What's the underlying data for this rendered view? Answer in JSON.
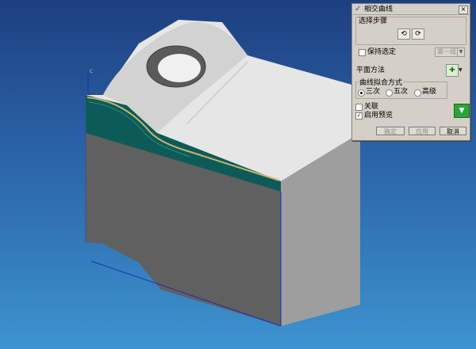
{
  "dialog": {
    "title": "相交曲线",
    "close_label": "×",
    "select_step": {
      "label": "选择步骤",
      "icons": [
        "first-face-icon",
        "second-face-icon"
      ]
    },
    "keep_selected": {
      "label": "保持选定",
      "checked": false
    },
    "set_dropdown": {
      "value": "第一组"
    },
    "plane_method": {
      "label": "平面方法",
      "icon": "plane-tool-icon"
    },
    "curve_fit": {
      "label": "曲线拟合方式",
      "options": [
        {
          "label": "三次",
          "selected": true
        },
        {
          "label": "五次",
          "selected": false
        },
        {
          "label": "高级",
          "selected": false
        }
      ]
    },
    "associate": {
      "label": "关联",
      "checked": false
    },
    "preview": {
      "label": "启用预览",
      "checked": true
    },
    "buttons": {
      "ok": "确定",
      "apply": "应用",
      "cancel": "取消"
    }
  },
  "viewport": {
    "axis_label": "C",
    "colors": {
      "background_top": "#1d3f80",
      "background_bottom": "#3d93cf",
      "top_face": "#e6e6e6",
      "side_face": "#606060",
      "right_face": "#9e9e9e",
      "band": "#0d5b58",
      "curve": "#c8b46a",
      "edges": "#1c2fa6"
    }
  }
}
